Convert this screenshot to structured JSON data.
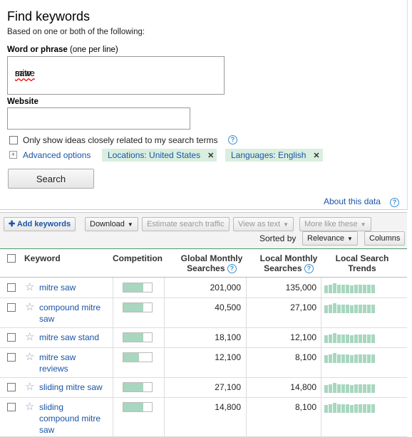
{
  "find": {
    "title": "Find keywords",
    "subtitle": "Based on one or both of the following:",
    "word_label_bold": "Word or phrase",
    "word_label_note": "(one per line)",
    "word_value_a": "mitre",
    "word_value_b": " saw",
    "website_label": "Website",
    "website_value": "",
    "only_show_label": "Only show ideas closely related to my search terms",
    "advanced_label": "Advanced options",
    "location_chip": "Locations: United States",
    "language_chip": "Languages: English",
    "search_button": "Search",
    "about_link": "About this data"
  },
  "toolbar": {
    "add_keywords": "Add keywords",
    "download": "Download",
    "estimate": "Estimate search traffic",
    "view_as_text": "View as text",
    "more_like": "More like these",
    "sorted_by": "Sorted by",
    "sort_value": "Relevance",
    "columns": "Columns"
  },
  "table": {
    "headers": {
      "keyword": "Keyword",
      "competition": "Competition",
      "global_1": "Global Monthly",
      "global_2": "Searches",
      "local_1": "Local Monthly",
      "local_2": "Searches",
      "trends_1": "Local Search",
      "trends_2": "Trends"
    },
    "rows": [
      {
        "kw_l1": "mitre saw",
        "kw_l2": "",
        "kw_l3": "",
        "competition": 0.7,
        "global": "201,000",
        "local": "135,000"
      },
      {
        "kw_l1": "compound mitre",
        "kw_l2": "saw",
        "kw_l3": "",
        "competition": 0.7,
        "global": "40,500",
        "local": "27,100"
      },
      {
        "kw_l1": "mitre saw stand",
        "kw_l2": "",
        "kw_l3": "",
        "competition": 0.7,
        "global": "18,100",
        "local": "12,100"
      },
      {
        "kw_l1": "mitre saw",
        "kw_l2": "reviews",
        "kw_l3": "",
        "competition": 0.55,
        "global": "12,100",
        "local": "8,100"
      },
      {
        "kw_l1": "sliding mitre saw",
        "kw_l2": "",
        "kw_l3": "",
        "competition": 0.7,
        "global": "27,100",
        "local": "14,800"
      },
      {
        "kw_l1": "sliding",
        "kw_l2": "compound mitre",
        "kw_l3": "saw",
        "competition": 0.7,
        "global": "14,800",
        "local": "8,100"
      }
    ]
  },
  "colors": {
    "link": "#1a55a5",
    "competition_fill": "#a8d7bf",
    "chip_bg": "#d9eedf"
  },
  "icons": [
    "help-icon",
    "expand-icon",
    "remove-icon",
    "plus-icon",
    "star-icon",
    "caret-down-icon"
  ]
}
